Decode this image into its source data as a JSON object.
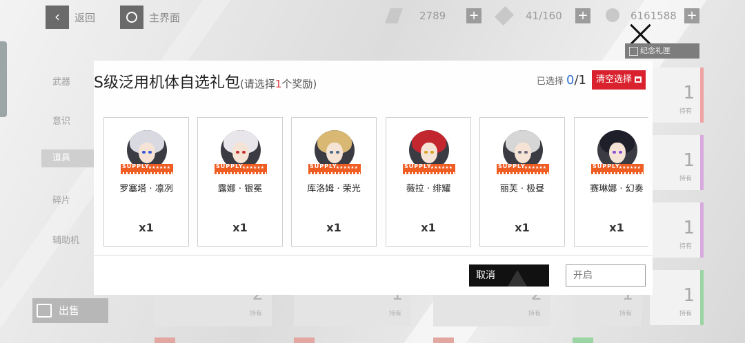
{
  "topbar": {
    "back_label": "返回",
    "home_label": "主界面",
    "resources": [
      {
        "icon": "ticket-icon",
        "value": "2789"
      },
      {
        "icon": "wrench-icon",
        "value": "41/160"
      },
      {
        "icon": "coin-icon",
        "value": "6161588"
      }
    ],
    "memorial_tab": "纪念礼匣"
  },
  "sidebar": {
    "categories": [
      "武器",
      "意识",
      "道具",
      "碎片",
      "辅助机"
    ],
    "sell_label": "出售"
  },
  "inventory": {
    "right_cards": [
      {
        "count": "1",
        "label": "持有"
      },
      {
        "count": "1",
        "label": "持有"
      },
      {
        "count": "1",
        "label": "持有"
      },
      {
        "count": "1",
        "label": "持有"
      }
    ],
    "bottom_cards": [
      {
        "count": "2",
        "label": "持有"
      },
      {
        "count": "1",
        "label": "持有"
      },
      {
        "count": "2",
        "label": "持有"
      },
      {
        "count": "1",
        "label": "持有"
      }
    ]
  },
  "dialog": {
    "title": "S级泛用机体自选礼包",
    "subtitle_prefix": "(请选择",
    "subtitle_count": "1",
    "subtitle_suffix": "个奖励)",
    "selected_label": "已选择",
    "selected_current": "0",
    "selected_total": "/1",
    "clear_label": "清空选择",
    "cancel_label": "取消",
    "open_label": "开启",
    "rank_text": "SUPPLY",
    "rank_stars": "★★★★★★",
    "options": [
      {
        "name": "罗塞塔 · 凛冽",
        "qty": "x1",
        "hair": "#d9d9e2",
        "eyes": "#3b5bd8"
      },
      {
        "name": "露娜 · 银冕",
        "qty": "x1",
        "hair": "#e8e6ea",
        "eyes": "#c42f2f"
      },
      {
        "name": "库洛姆 · 荣光",
        "qty": "x1",
        "hair": "#d9b873",
        "eyes": "#4a6a8a"
      },
      {
        "name": "薇拉 · 绯耀",
        "qty": "x1",
        "hair": "#c2262f",
        "eyes": "#d9a21f"
      },
      {
        "name": "丽芙 · 极昼",
        "qty": "x1",
        "hair": "#d6d6d6",
        "eyes": "#6b6b7a"
      },
      {
        "name": "赛琳娜 · 幻奏",
        "qty": "x1",
        "hair": "#1f1f2a",
        "eyes": "#8a4fd6"
      }
    ]
  }
}
